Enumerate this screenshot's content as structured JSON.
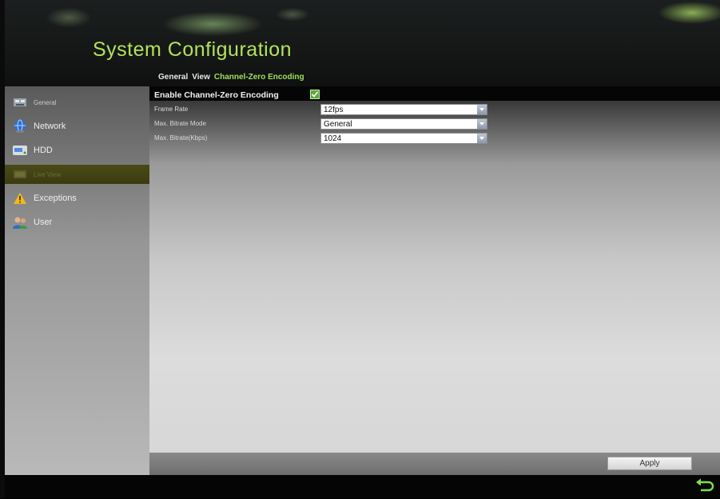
{
  "header": {
    "title": "System Configuration"
  },
  "tabs": [
    {
      "label": "General",
      "active": false
    },
    {
      "label": "View",
      "active": false
    },
    {
      "label": "Channel-Zero Encoding",
      "active": true
    }
  ],
  "sidebar": {
    "items": [
      {
        "label": "General",
        "icon": "general-icon",
        "active": false
      },
      {
        "label": "Network",
        "icon": "network-icon",
        "active": false
      },
      {
        "label": "HDD",
        "icon": "hdd-icon",
        "active": false
      },
      {
        "label": "Live View",
        "icon": "live-view-icon",
        "active": true
      },
      {
        "label": "Exceptions",
        "icon": "warning-icon",
        "active": false
      },
      {
        "label": "User",
        "icon": "user-icon",
        "active": false
      }
    ]
  },
  "main": {
    "enable_label": "Enable Channel-Zero Encoding",
    "enable_checked": true,
    "frame_rate": {
      "label": "Frame Rate",
      "value": "12fps"
    },
    "bitrate_mode": {
      "label": "Max. Bitrate Mode",
      "value": "General"
    },
    "bitrate": {
      "label": "Max. Bitrate(Kbps)",
      "value": "1024"
    }
  },
  "footer": {
    "apply_label": "Apply"
  },
  "colors": {
    "accent": "#b3e35a",
    "active_tab": "#9fe05a",
    "checkbox": "#59a83a"
  }
}
